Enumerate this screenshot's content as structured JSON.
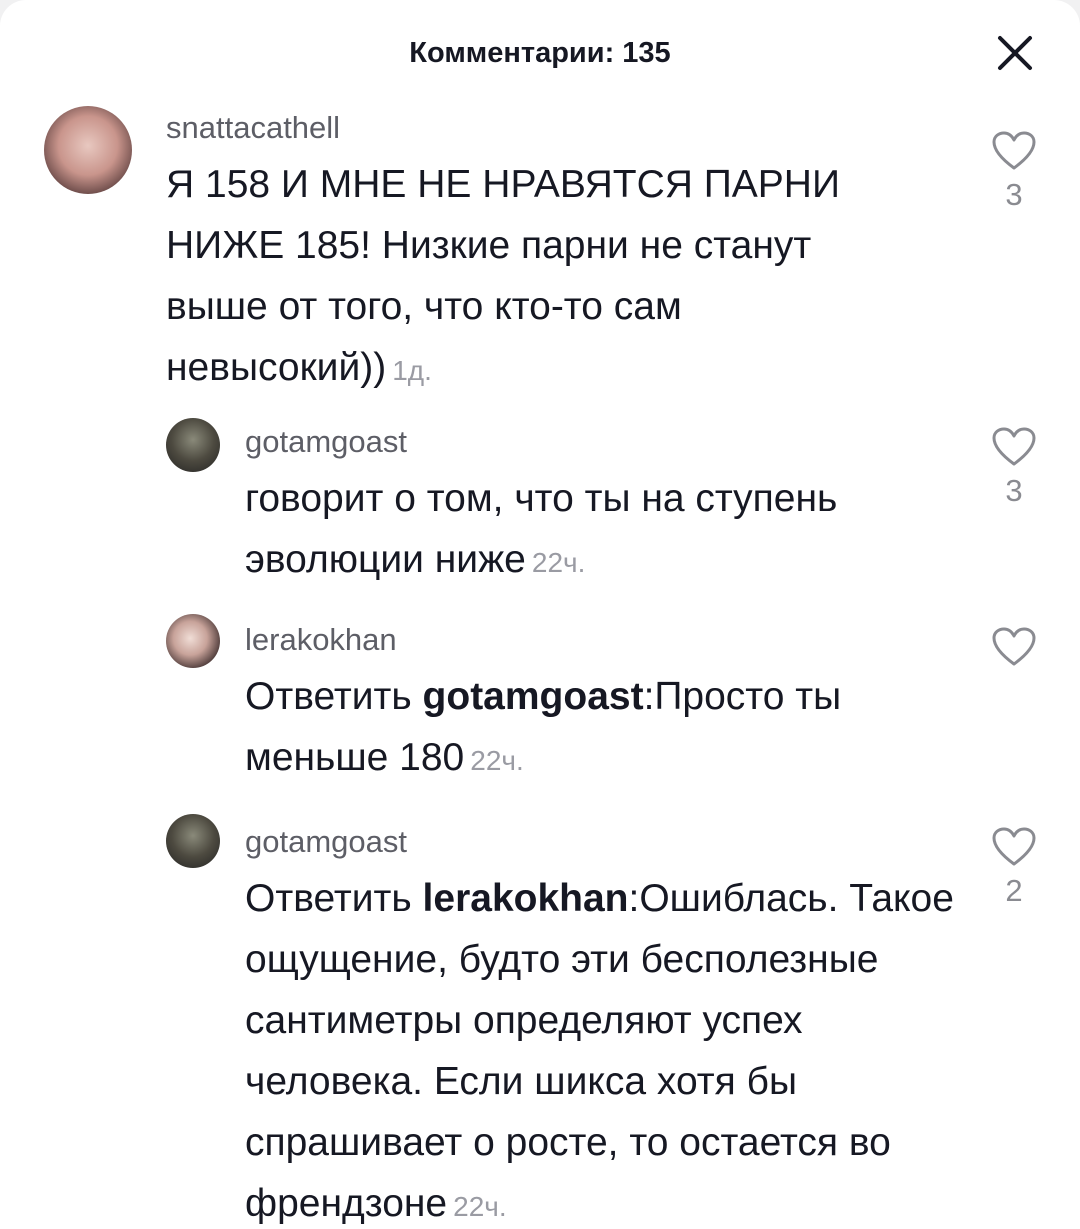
{
  "header": {
    "title": "Комментарии: 135"
  },
  "comments": [
    {
      "username": "snattacathell",
      "text": "Я 158 И МНЕ НЕ НРАВЯТСЯ ПАРНИ НИЖЕ 185! Низкие парни не станут выше от того, что кто-то сам невысокий))",
      "time": "1д.",
      "likes": "3"
    },
    {
      "username": "gotamgoast",
      "text": "говорит о том, что ты на ступень эволюции ниже",
      "time": "22ч.",
      "likes": "3"
    },
    {
      "username": "lerakokhan",
      "reply_prefix": "Ответить ",
      "reply_to": "gotamgoast",
      "text": ":Просто ты меньше 180",
      "time": "22ч.",
      "likes": ""
    },
    {
      "username": "gotamgoast",
      "reply_prefix": "Ответить ",
      "reply_to": "lerakokhan",
      "text": ":Ошиблась. Такое ощущение, будто эти бесполезные сантиметры определяют успех человека. Если шикса хотя бы спрашивает о росте, то остается во френдзоне",
      "time": "22ч.",
      "likes": "2"
    }
  ]
}
